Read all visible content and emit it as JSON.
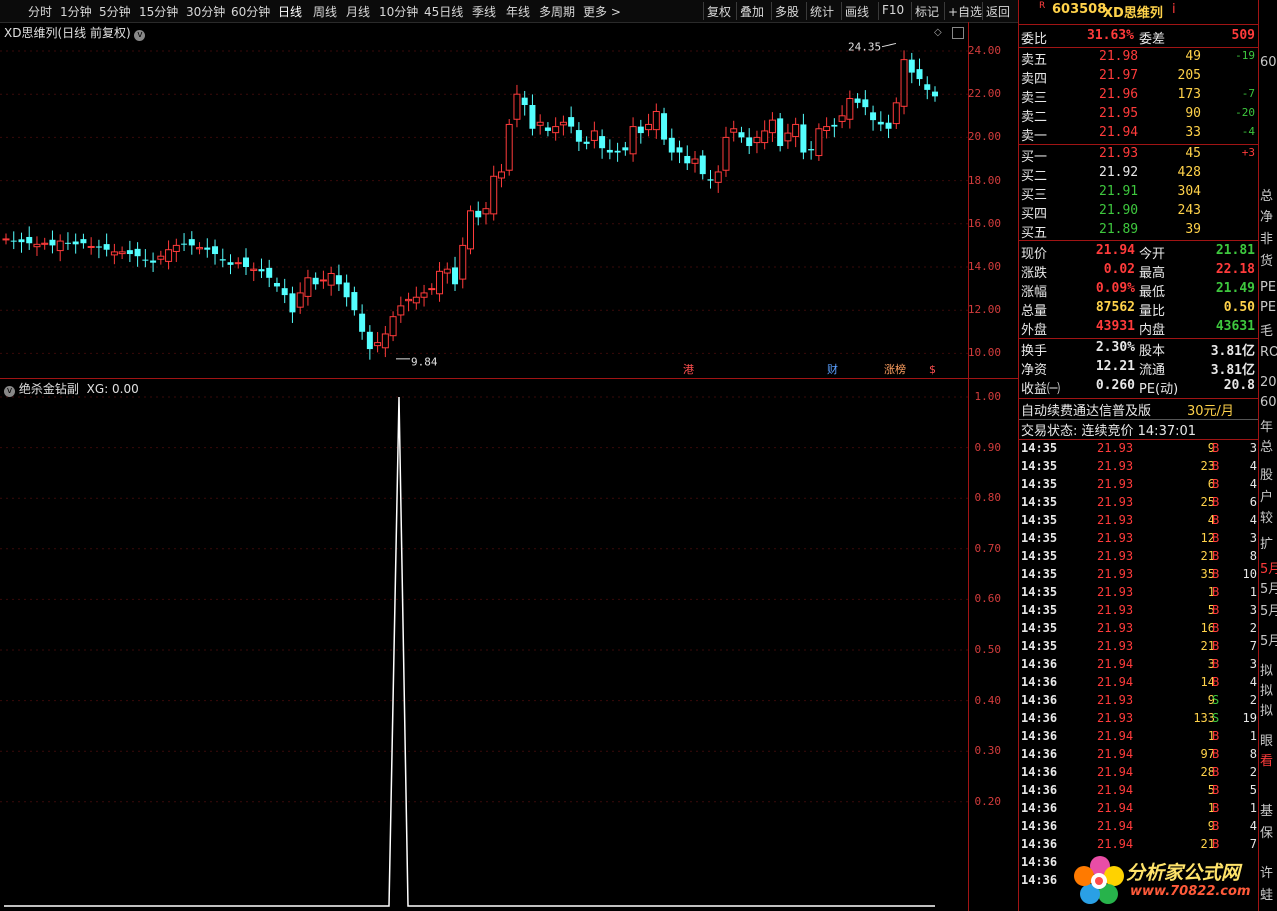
{
  "toolbar": {
    "periods": [
      "分时",
      "1分钟",
      "5分钟",
      "15分钟",
      "30分钟",
      "60分钟",
      "日线",
      "周线",
      "月线",
      "10分钟",
      "45日线",
      "季线",
      "年线",
      "多周期",
      "更多 >"
    ],
    "actions": [
      "复权",
      "叠加",
      "多股",
      "统计",
      "画线",
      "F10",
      "标记",
      "+自选",
      "返回"
    ]
  },
  "main_chart": {
    "title": "XD思维列(日线 前复权)",
    "high_label": "24.35",
    "low_label": "9.84",
    "y_ticks": [
      "24.00",
      "22.00",
      "20.00",
      "18.00",
      "16.00",
      "14.00",
      "12.00",
      "10.00"
    ],
    "events": [
      {
        "label": "港",
        "color": "#ff5050"
      },
      {
        "label": "财",
        "color": "#5aa0ff"
      },
      {
        "label": "涨榜",
        "color": "#ffa060"
      },
      {
        "label": "$",
        "color": "#ff5050"
      }
    ]
  },
  "indicator": {
    "title": "绝杀金钻副",
    "value_label": "XG: 0.00",
    "y_ticks": [
      "1.00",
      "0.90",
      "0.80",
      "0.70",
      "0.60",
      "0.50",
      "0.40",
      "0.30",
      "0.20"
    ]
  },
  "quote": {
    "flag": "R",
    "code": "603508",
    "name": "XD思维列",
    "info_mark": "i",
    "weibi_label": "委比",
    "weibi": "31.63%",
    "weicha_label": "委差",
    "weicha": "509",
    "sells": [
      {
        "label": "卖五",
        "price": "21.98",
        "vol": "49",
        "chg": "-19"
      },
      {
        "label": "卖四",
        "price": "21.97",
        "vol": "205",
        "chg": ""
      },
      {
        "label": "卖三",
        "price": "21.96",
        "vol": "173",
        "chg": "-7"
      },
      {
        "label": "卖二",
        "price": "21.95",
        "vol": "90",
        "chg": "-20"
      },
      {
        "label": "卖一",
        "price": "21.94",
        "vol": "33",
        "chg": "-4"
      }
    ],
    "buys": [
      {
        "label": "买一",
        "price": "21.93",
        "vol": "45",
        "chg": "+3"
      },
      {
        "label": "买二",
        "price": "21.92",
        "vol": "428",
        "chg": ""
      },
      {
        "label": "买三",
        "price": "21.91",
        "vol": "304",
        "chg": ""
      },
      {
        "label": "买四",
        "price": "21.90",
        "vol": "243",
        "chg": ""
      },
      {
        "label": "买五",
        "price": "21.89",
        "vol": "39",
        "chg": ""
      }
    ],
    "stats": [
      {
        "l1": "现价",
        "v1": "21.94",
        "l2": "今开",
        "v2": "21.81"
      },
      {
        "l1": "涨跌",
        "v1": "0.02",
        "l2": "最高",
        "v2": "22.18"
      },
      {
        "l1": "涨幅",
        "v1": "0.09%",
        "l2": "最低",
        "v2": "21.49"
      },
      {
        "l1": "总量",
        "v1": "87562",
        "l2": "量比",
        "v2": "0.50"
      },
      {
        "l1": "外盘",
        "v1": "43931",
        "l2": "内盘",
        "v2": "43631"
      }
    ],
    "fund": [
      {
        "l1": "换手",
        "v1": "2.30%",
        "l2": "股本",
        "v2": "3.81亿"
      },
      {
        "l1": "净资",
        "v1": "12.21",
        "l2": "流通",
        "v2": "3.81亿"
      },
      {
        "l1": "收益㈠",
        "v1": "0.260",
        "l2": "PE(动)",
        "v2": "20.8"
      }
    ],
    "promo": "自动续费通达信普及版",
    "promo_price": "30元/月",
    "trade_status": "交易状态: 连续竞价 14:37:01"
  },
  "ticks": [
    [
      "14:35",
      "21.93",
      "9",
      "B",
      "3"
    ],
    [
      "14:35",
      "21.93",
      "23",
      "B",
      "4"
    ],
    [
      "14:35",
      "21.93",
      "6",
      "B",
      "4"
    ],
    [
      "14:35",
      "21.93",
      "25",
      "B",
      "6"
    ],
    [
      "14:35",
      "21.93",
      "4",
      "B",
      "4"
    ],
    [
      "14:35",
      "21.93",
      "12",
      "B",
      "3"
    ],
    [
      "14:35",
      "21.93",
      "21",
      "B",
      "8"
    ],
    [
      "14:35",
      "21.93",
      "35",
      "B",
      "10"
    ],
    [
      "14:35",
      "21.93",
      "1",
      "B",
      "1"
    ],
    [
      "14:35",
      "21.93",
      "5",
      "B",
      "3"
    ],
    [
      "14:35",
      "21.93",
      "16",
      "B",
      "2"
    ],
    [
      "14:35",
      "21.93",
      "21",
      "B",
      "7"
    ],
    [
      "14:36",
      "21.94",
      "3",
      "B",
      "3"
    ],
    [
      "14:36",
      "21.94",
      "14",
      "B",
      "4"
    ],
    [
      "14:36",
      "21.93",
      "9",
      "S",
      "2"
    ],
    [
      "14:36",
      "21.93",
      "133",
      "S",
      "19"
    ],
    [
      "14:36",
      "21.94",
      "1",
      "B",
      "1"
    ],
    [
      "14:36",
      "21.94",
      "97",
      "B",
      "8"
    ],
    [
      "14:36",
      "21.94",
      "28",
      "B",
      "2"
    ],
    [
      "14:36",
      "21.94",
      "5",
      "B",
      "5"
    ],
    [
      "14:36",
      "21.94",
      "1",
      "B",
      "1"
    ],
    [
      "14:36",
      "21.94",
      "9",
      "B",
      "4"
    ],
    [
      "14:36",
      "21.94",
      "21",
      "B",
      "7"
    ],
    [
      "14:36",
      "",
      "",
      "",
      ""
    ],
    [
      "14:36",
      "",
      "",
      "",
      ""
    ]
  ],
  "far_right": [
    "60",
    "总",
    "净",
    "非",
    "货",
    "PE",
    "PE",
    "毛",
    "RO",
    "20",
    "60",
    "年",
    "总",
    "股",
    "户",
    "较",
    "扩",
    "5月",
    "5月",
    "5月",
    "5月",
    "拟",
    "拟",
    "拟",
    "眼",
    "看",
    "",
    "基",
    "保",
    "许",
    "蛙"
  ],
  "watermark": {
    "title": "分析家公式网",
    "url": "www.70822.com"
  }
}
